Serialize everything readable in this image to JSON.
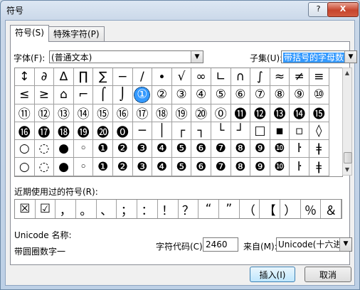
{
  "window": {
    "title": "符号",
    "help": "?",
    "close": "X"
  },
  "tabs": [
    {
      "label": "符号(S)"
    },
    {
      "label": "特殊字符(P)"
    }
  ],
  "font": {
    "label": "字体(F):",
    "value": "(普通文本)"
  },
  "subset": {
    "label": "子集(U):",
    "value": "带括号的字母数字"
  },
  "symbols": [
    [
      "↕",
      "∂",
      "∆",
      "∏",
      "∑",
      "−",
      "∕",
      "∙",
      "√",
      "∞",
      "∟",
      "∩",
      "∫",
      "≈",
      "≠",
      "≡"
    ],
    [
      "≤",
      "≥",
      "⌂",
      "⌐",
      "⌠",
      "⌡",
      "①",
      "②",
      "③",
      "④",
      "⑤",
      "⑥",
      "⑦",
      "⑧",
      "⑨",
      "⑩"
    ],
    [
      "⑪",
      "⑫",
      "⑬",
      "⑭",
      "⑮",
      "⑯",
      "⑰",
      "⑱",
      "⑲",
      "⑳",
      "⓪",
      "⓫",
      "⓬",
      "⓭",
      "⓮",
      "⓯"
    ],
    [
      "⓰",
      "⓱",
      "⓲",
      "⓳",
      "⓴",
      "⓿",
      "─",
      "│",
      "┌",
      "┐",
      "└",
      "┘",
      "□",
      "▪",
      "▫",
      "◊"
    ],
    [
      "○",
      "◌",
      "●",
      "◦",
      "❶",
      "❷",
      "❸",
      "❹",
      "❺",
      "❻",
      "❼",
      "❽",
      "❾",
      "❿",
      "ŀ",
      "ǂ"
    ]
  ],
  "extra_row": [
    "○",
    "◌",
    "●",
    "◦",
    "❶",
    "❷",
    "❸",
    "❹",
    "❺",
    "❻",
    "❼",
    "❽",
    "❾",
    "❿",
    "ŀ",
    "ǂ"
  ],
  "selected_symbol": "①",
  "recent": {
    "label": "近期使用过的符号(R):",
    "symbols": [
      "☒",
      "☑",
      "，",
      "。",
      "、",
      "；",
      "：",
      "！",
      "？",
      "“",
      "”",
      "（",
      "【",
      "）",
      "％",
      "＆"
    ]
  },
  "unicode": {
    "label": "Unicode 名称:",
    "name": "带圆圈数字一"
  },
  "char_code": {
    "label": "字符代码(C):",
    "value": "2460"
  },
  "from": {
    "label": "来自(M):",
    "value": "Unicode(十六进"
  },
  "buttons": {
    "insert": "插入(I)",
    "cancel": "取消"
  }
}
